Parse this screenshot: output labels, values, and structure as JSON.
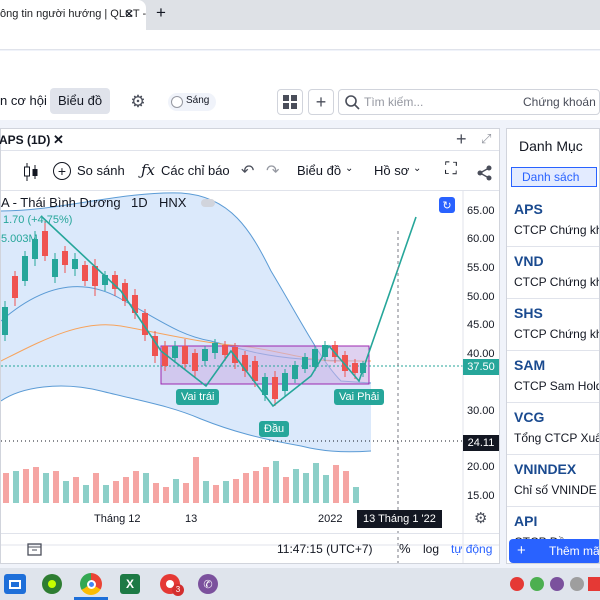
{
  "browser": {
    "tab_title": "ông tin người hướng | QLCT - ",
    "tab_close": "✕",
    "new_tab": "+"
  },
  "toolbar": {
    "nav_item": "n cơ hội",
    "chart_button": "Biểu đồ",
    "theme_toggle": "Sáng",
    "search_placeholder": "Tìm kiếm...",
    "search_category": "Chứng khoán"
  },
  "chart_header": {
    "symbol_tab": "APS (1D)",
    "compare_label": "So sánh",
    "indicators_label": "Các chỉ báo",
    "chart_type_label": "Biểu đồ",
    "profile_label": "Hồ sơ",
    "legend_title": "A - Thái Bình Dương",
    "interval": "1D",
    "exchange": "HNX",
    "change_text": "1.70 (+4.75%)",
    "volume_text": "5.003M"
  },
  "annotations": {
    "left_shoulder": "Vai trái",
    "head": "Đầu",
    "right_shoulder": "Vai Phải"
  },
  "price_axis": {
    "ticks": [
      "65.00",
      "60.00",
      "55.00",
      "50.00",
      "45.00",
      "40.00",
      "35.00",
      "30.00",
      "20.00",
      "15.00"
    ],
    "last_price": "37.50",
    "volume_marker": "24.11"
  },
  "time_axis": {
    "labels": [
      "Tháng 12",
      "13",
      "2022"
    ],
    "crosshair_label": "13 Tháng 1 '22"
  },
  "status_bar": {
    "time": "11:47:15 (UTC+7)",
    "percent": "%",
    "log": "log",
    "auto": "tự động"
  },
  "watchlist": {
    "title": "Danh Mục",
    "tab": "Danh sách",
    "items": [
      {
        "symbol": "APS",
        "name": "CTCP Chứng kh"
      },
      {
        "symbol": "VND",
        "name": "CTCP Chứng kh"
      },
      {
        "symbol": "SHS",
        "name": "CTCP Chứng kh"
      },
      {
        "symbol": "SAM",
        "name": "CTCP Sam Hold"
      },
      {
        "symbol": "VCG",
        "name": "Tổng CTCP Xuấ"
      },
      {
        "symbol": "VNINDEX",
        "name": "Chỉ số VNINDE"
      },
      {
        "symbol": "API",
        "name": "CTCP Đầu"
      }
    ],
    "add_button": "Thêm mã"
  },
  "taskbar": {
    "badge_count": "3"
  },
  "colors": {
    "up": "#26a69a",
    "down": "#ef5350",
    "accent": "#2962ff",
    "pattern_fill": "#c9b3e6",
    "bollinger_fill": "#dbe9fb"
  }
}
